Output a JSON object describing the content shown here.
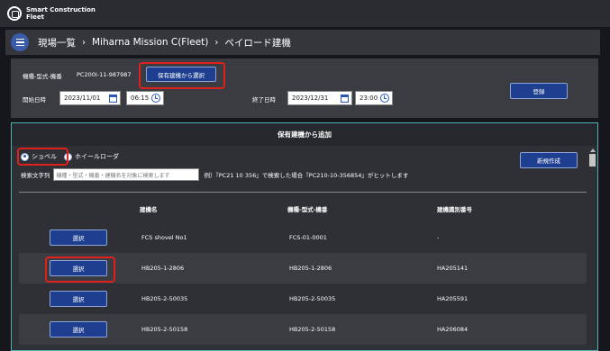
{
  "app": {
    "brand_line1": "Smart Construction",
    "brand_line2": "Fleet"
  },
  "breadcrumb": {
    "item1": "現場一覧",
    "item2": "Miharna Mission C(Fleet)",
    "item3": "ペイロード建機",
    "separator": "›"
  },
  "form": {
    "model_label": "機種-型式-機番",
    "model_value": "PC200I-11-987987",
    "select_owned_button": "保有建機から選択",
    "start_label": "開始日時",
    "start_date": "2023/11/01",
    "start_time": "06:15",
    "end_label": "終了日時",
    "end_date": "2023/12/31",
    "end_time": "23:00",
    "register_button": "登録"
  },
  "modal": {
    "title": "保有建機から追加",
    "radio_shovel": "ショベル",
    "radio_wheel_loader": "ホイールローダ",
    "selected_radio": "ショベル",
    "new_button": "新規作成",
    "search_label": "検索文字列",
    "search_placeholder": "機種・型式・機番・建機名を対象に検索します",
    "search_hint": "例）『PC21 10 356』で検索した場合『PC210-10-356854』がヒットします",
    "columns": [
      "建機名",
      "機種-型式-機番",
      "建機識別番号"
    ],
    "select_label": "選択",
    "rows": [
      {
        "name": "FCS shovel No1",
        "model": "FCS-01-0001",
        "id": "-"
      },
      {
        "name": "HB205-1-2806",
        "model": "HB205-1-2806",
        "id": "HA205141"
      },
      {
        "name": "HB205-2-50035",
        "model": "HB205-2-50035",
        "id": "HA205591"
      },
      {
        "name": "HB205-2-50158",
        "model": "HB205-2-50158",
        "id": "HA206084"
      }
    ]
  },
  "colors": {
    "accent": "#1e3f8f",
    "highlight": "#e0201a",
    "modal_border": "#4fb3b0"
  }
}
